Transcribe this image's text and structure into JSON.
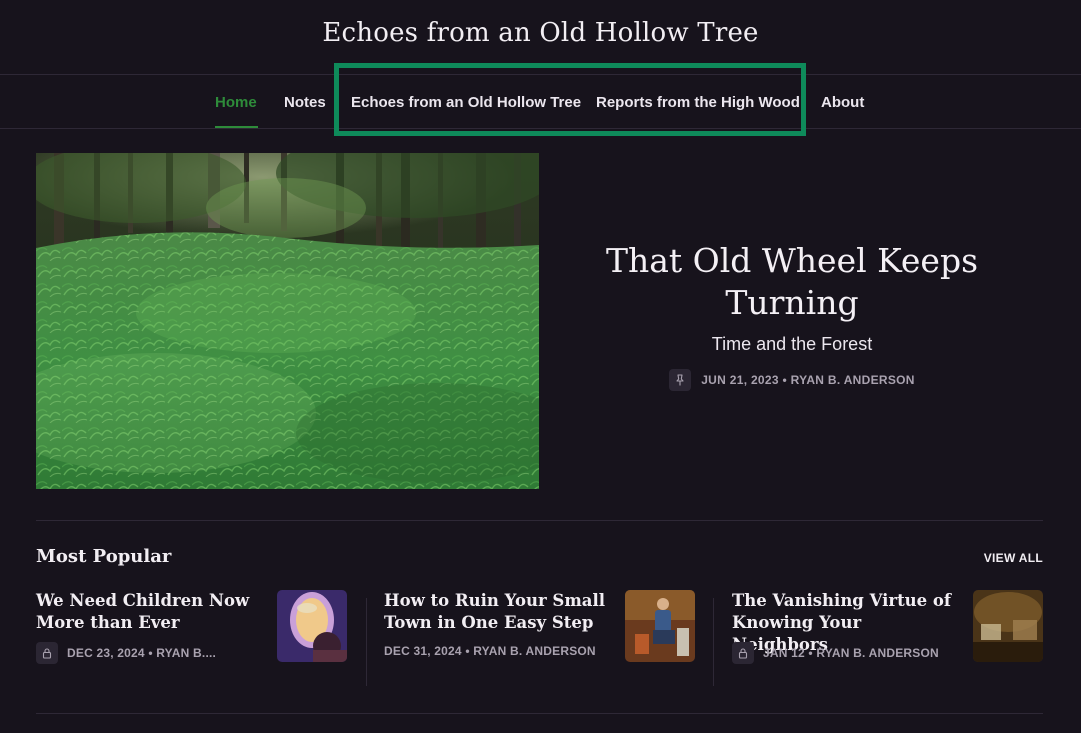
{
  "site": {
    "title": "Echoes from an Old Hollow Tree"
  },
  "nav": {
    "items": [
      {
        "label": "Home",
        "active": true
      },
      {
        "label": "Notes"
      },
      {
        "label": "Echoes from an Old Hollow Tree"
      },
      {
        "label": "Reports from the High Wood"
      },
      {
        "label": "About"
      }
    ]
  },
  "hero": {
    "title": "That Old Wheel Keeps Turning",
    "subtitle": "Time and the Forest",
    "meta": "JUN 21, 2023 • RYAN B. ANDERSON",
    "meta_icon": "pin-icon"
  },
  "popular": {
    "heading": "Most Popular",
    "view_all": "VIEW ALL",
    "posts": [
      {
        "title": "We Need Children Now More than Ever",
        "meta": "DEC 23, 2024 • RYAN B....",
        "icon": "lock-icon"
      },
      {
        "title": "How to Ruin Your Small Town in One Easy Step",
        "meta": "DEC 31, 2024 • RYAN B. ANDERSON",
        "icon": ""
      },
      {
        "title": "The Vanishing Virtue of Knowing Your Neighbors",
        "meta": "JAN 12 • RYAN B. ANDERSON",
        "icon": "lock-icon"
      }
    ]
  },
  "colors": {
    "background": "#17131c",
    "accent": "#2e8b3a",
    "highlight": "#0e8a5a"
  }
}
